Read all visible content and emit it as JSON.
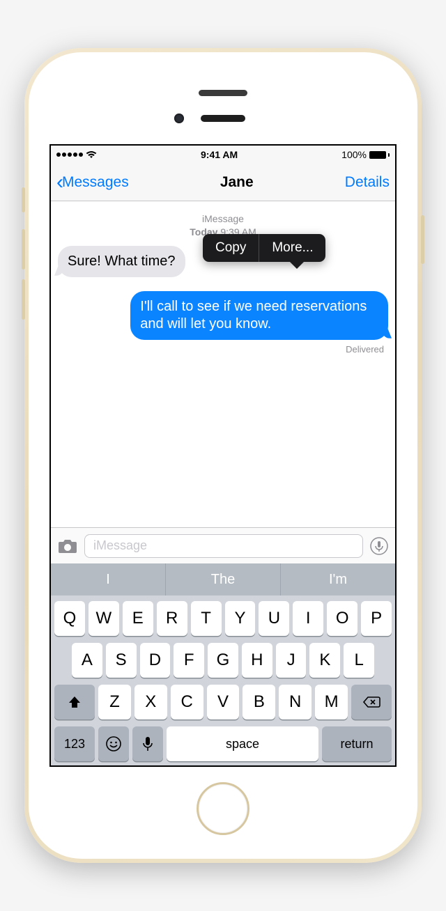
{
  "status": {
    "time": "9:41 AM",
    "battery_pct": "100%"
  },
  "nav": {
    "back_label": "Messages",
    "title": "Jane",
    "details_label": "Details"
  },
  "thread": {
    "service": "iMessage",
    "day": "Today",
    "time": "9:39 AM",
    "incoming_text": "Sure! What time?",
    "outgoing_text": "I'll call to see if we need reservations and will let you know.",
    "delivered_label": "Delivered"
  },
  "context_menu": {
    "copy": "Copy",
    "more": "More..."
  },
  "compose": {
    "placeholder": "iMessage"
  },
  "predictive": {
    "s1": "I",
    "s2": "The",
    "s3": "I'm"
  },
  "keyboard": {
    "row1": [
      "Q",
      "W",
      "E",
      "R",
      "T",
      "Y",
      "U",
      "I",
      "O",
      "P"
    ],
    "row2": [
      "A",
      "S",
      "D",
      "F",
      "G",
      "H",
      "J",
      "K",
      "L"
    ],
    "row3": [
      "Z",
      "X",
      "C",
      "V",
      "B",
      "N",
      "M"
    ],
    "num": "123",
    "space": "space",
    "return": "return"
  }
}
